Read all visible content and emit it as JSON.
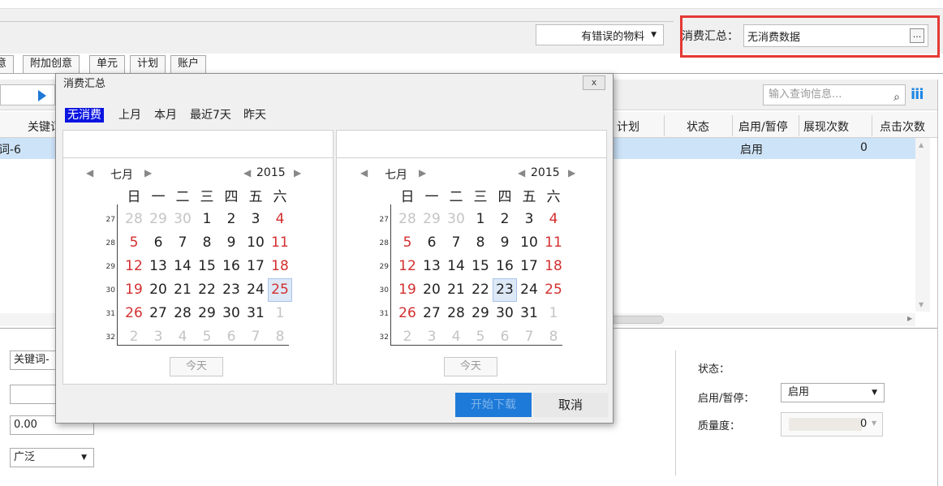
{
  "toolbar": {
    "error_filter": "有错误的物料",
    "consume_label": "消费汇总：",
    "consume_value": "无消费数据",
    "more_btn": "..."
  },
  "tabs": [
    "意",
    "附加创意",
    "单元",
    "计划",
    "账户"
  ],
  "grid": {
    "search_placeholder": "输入查询信息...",
    "headers": [
      "关键词",
      "计划",
      "状态",
      "启用/暂停",
      "展现次数",
      "点击次数"
    ],
    "row1": {
      "keyword": "词-6",
      "enable": "启用",
      "impressions": "0"
    }
  },
  "bottom": {
    "keyword_value": "关键词-",
    "price_value": "0.00",
    "match_value": "广泛",
    "status_label": "状态：",
    "enable_label": "启用/暂停：",
    "enable_value": "启用",
    "quality_label": "质量度：",
    "quality_value": "0"
  },
  "dialog": {
    "title": "消费汇总",
    "close": "x",
    "presets": [
      "无消费",
      "上月",
      "本月",
      "最近7天",
      "昨天"
    ],
    "weekdays": [
      "日",
      "一",
      "二",
      "三",
      "四",
      "五",
      "六"
    ],
    "today_label": "今天",
    "start_download": "开始下载",
    "cancel": "取消",
    "left_calendar": {
      "month": "七月",
      "year": "2015",
      "selected": 25
    },
    "right_calendar": {
      "month": "七月",
      "year": "2015",
      "selected": 23
    },
    "week_numbers": [
      "27",
      "28",
      "29",
      "30",
      "31",
      "32"
    ],
    "weeks": [
      [
        [
          "28",
          "m"
        ],
        [
          "29",
          "m"
        ],
        [
          "30",
          "m"
        ],
        [
          "1",
          ""
        ],
        [
          "2",
          ""
        ],
        [
          "3",
          ""
        ],
        [
          "4",
          "r"
        ]
      ],
      [
        [
          "5",
          "r"
        ],
        [
          "6",
          ""
        ],
        [
          "7",
          ""
        ],
        [
          "8",
          ""
        ],
        [
          "9",
          ""
        ],
        [
          "10",
          ""
        ],
        [
          "11",
          "r"
        ]
      ],
      [
        [
          "12",
          "r"
        ],
        [
          "13",
          ""
        ],
        [
          "14",
          ""
        ],
        [
          "15",
          ""
        ],
        [
          "16",
          ""
        ],
        [
          "17",
          ""
        ],
        [
          "18",
          "r"
        ]
      ],
      [
        [
          "19",
          "r"
        ],
        [
          "20",
          ""
        ],
        [
          "21",
          ""
        ],
        [
          "22",
          ""
        ],
        [
          "23",
          ""
        ],
        [
          "24",
          ""
        ],
        [
          "25",
          "r"
        ]
      ],
      [
        [
          "26",
          "r"
        ],
        [
          "27",
          ""
        ],
        [
          "28",
          ""
        ],
        [
          "29",
          ""
        ],
        [
          "30",
          ""
        ],
        [
          "31",
          ""
        ],
        [
          "1",
          "m"
        ]
      ],
      [
        [
          "2",
          "m"
        ],
        [
          "3",
          "m"
        ],
        [
          "4",
          "m"
        ],
        [
          "5",
          "m"
        ],
        [
          "6",
          "m"
        ],
        [
          "7",
          "m"
        ],
        [
          "8",
          "m"
        ]
      ]
    ]
  },
  "colors": {
    "accent": "#1e7ad8",
    "highlight_box": "#e53935",
    "selected_row": "#cde3f8",
    "weekend_red": "#d32f2f",
    "preset_active": "#0a14e0"
  }
}
